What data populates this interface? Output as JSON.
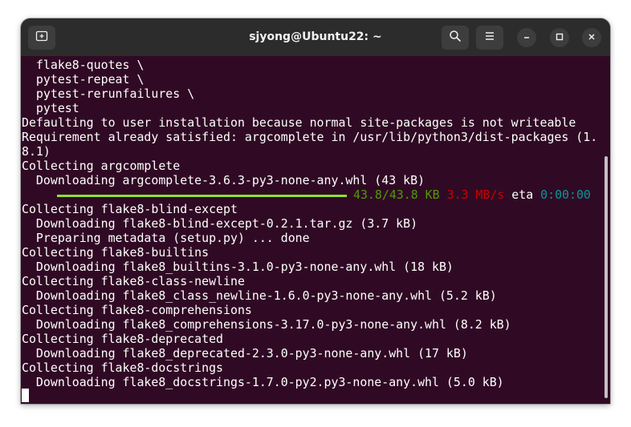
{
  "window": {
    "title": "sjyong@Ubuntu22: ~",
    "colors": {
      "titlebar": "#2c2c2c",
      "terminal_bg": "#300a24",
      "text": "#ffffff"
    }
  },
  "icons": {
    "new_tab": "new-tab-icon",
    "search": "search-icon",
    "menu": "hamburger-menu-icon",
    "minimize": "minimize-icon",
    "maximize": "maximize-icon",
    "close": "close-icon"
  },
  "terminal": {
    "lines": [
      "  flake8-quotes \\",
      "  pytest-repeat \\",
      "  pytest-rerunfailures \\",
      "  pytest",
      "Defaulting to user installation because normal site-packages is not writeable",
      "Requirement already satisfied: argcomplete in /usr/lib/python3/dist-packages (1.",
      "8.1)",
      "Collecting argcomplete",
      "  Downloading argcomplete-3.6.3-py3-none-any.whl (43 kB)",
      "",
      "Collecting flake8-blind-except",
      "  Downloading flake8-blind-except-0.2.1.tar.gz (3.7 kB)",
      "  Preparing metadata (setup.py) ... done",
      "Collecting flake8-builtins",
      "  Downloading flake8_builtins-3.1.0-py3-none-any.whl (18 kB)",
      "Collecting flake8-class-newline",
      "  Downloading flake8_class_newline-1.6.0-py3-none-any.whl (5.2 kB)",
      "Collecting flake8-comprehensions",
      "  Downloading flake8_comprehensions-3.17.0-py3-none-any.whl (8.2 kB)",
      "Collecting flake8-deprecated",
      "  Downloading flake8_deprecated-2.3.0-py3-none-any.whl (17 kB)",
      "Collecting flake8-docstrings",
      "  Downloading flake8_docstrings-1.7.0-py2.py3-none-any.whl (5.0 kB)"
    ],
    "progress": {
      "fraction": 1.0,
      "size": "43.8/43.8 KB",
      "speed": "3.3 MB/s",
      "eta_label": "eta",
      "eta": "0:00:00",
      "colors": {
        "bar": "#8ae234",
        "size": "#4e9a06",
        "speed": "#cc0000",
        "eta": "#06989a"
      }
    }
  }
}
